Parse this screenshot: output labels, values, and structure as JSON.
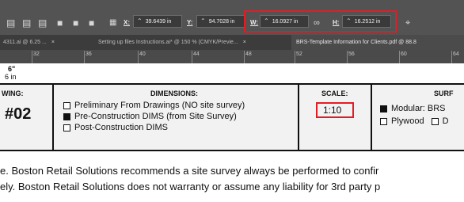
{
  "toolbar": {
    "x_label": "X:",
    "x_value": "39.6439 in",
    "y_label": "Y:",
    "y_value": "94.7028 in",
    "w_label": "W:",
    "w_value": "16.0927 in",
    "h_label": "H:",
    "h_value": "16.2512 in",
    "spin_glyph": "⌃"
  },
  "tabs": [
    {
      "label": "4311.ai @ 6.25 ...",
      "close": "×"
    },
    {
      "label": "Setting up files Instructions.ai* @ 150 % (CMYK/Previe...",
      "close": "×"
    },
    {
      "label": "BRS-Template Information for Clients.pdf @ 88.8",
      "close": ""
    }
  ],
  "ruler": {
    "marks": [
      "32",
      "36",
      "40",
      "44",
      "48",
      "52",
      "56",
      "60",
      "64"
    ]
  },
  "dimension": {
    "line1": "6\"",
    "line2": "6 in"
  },
  "title_block": {
    "drawing_header": "WING:",
    "drawing_number": "#02",
    "dimensions_header": "DIMENSIONS:",
    "dimension_options": [
      {
        "label": "Preliminary From Drawings (NO site survey)",
        "checked": false
      },
      {
        "label": "Pre-Construction DIMS (from Site Survey)",
        "checked": true
      },
      {
        "label": "Post-Construction DIMS",
        "checked": false
      }
    ],
    "scale_header": "SCALE:",
    "scale_value": "1:10",
    "surface_header": "SURF",
    "surface_line1": "Modular: BRS",
    "surface_line2_a": "Plywood",
    "surface_line2_b": "D"
  },
  "disclaimer": {
    "line1": "e. Boston Retail Solutions recommends a site survey always be performed to confir",
    "line2": "ely. Boston Retail Solutions does not warranty or assume any liability for 3rd party p"
  }
}
